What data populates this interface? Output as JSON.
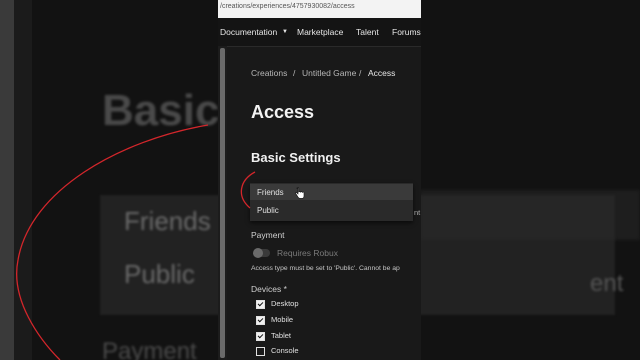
{
  "background": {
    "title": "Basic",
    "friends": "Friends",
    "public": "Public",
    "payment": "Payment",
    "right_word": "ent"
  },
  "browser": {
    "url": "/creations/experiences/4757930082/access"
  },
  "nav": {
    "items": [
      "Documentation",
      "Marketplace",
      "Talent",
      "Forums"
    ]
  },
  "breadcrumb": [
    "Creations",
    "Untitled Game",
    "Access"
  ],
  "breadcrumb_sep": "/",
  "page_title": "Access",
  "section_title": "Basic Settings",
  "dropdown": {
    "options": [
      "Friends",
      "Public"
    ],
    "highlighted": "Friends",
    "peek": "nt"
  },
  "payment": {
    "label": "Payment",
    "toggle_label": "Requires Robux",
    "toggle_on": false,
    "hint": "Access type must be set to 'Public'. Cannot be ap"
  },
  "devices": {
    "label": "Devices *",
    "items": [
      {
        "label": "Desktop",
        "checked": true
      },
      {
        "label": "Mobile",
        "checked": true
      },
      {
        "label": "Tablet",
        "checked": true
      },
      {
        "label": "Console",
        "checked": false
      }
    ]
  },
  "colors": {
    "annotation": "#d3262b",
    "page_bg": "#191919"
  }
}
